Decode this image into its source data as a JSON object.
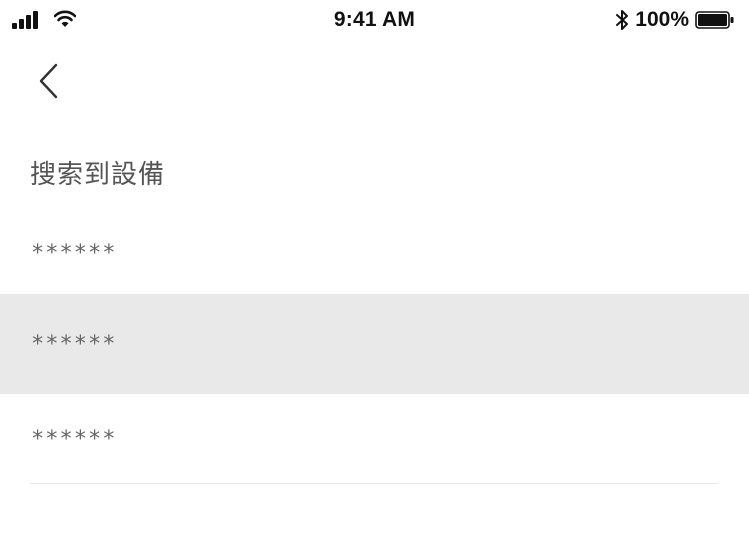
{
  "status_bar": {
    "time": "9:41 AM",
    "battery_percent": "100%",
    "battery_level": 1.0,
    "signal_icon": "signal-bars-icon",
    "wifi_icon": "wifi-icon",
    "bluetooth_icon": "bluetooth-icon",
    "battery_icon": "battery-icon"
  },
  "nav": {
    "back_icon": "chevron-left-icon"
  },
  "page": {
    "title": "搜索到設備"
  },
  "devices": [
    {
      "label": "******",
      "selected": false
    },
    {
      "label": "******",
      "selected": true
    },
    {
      "label": "******",
      "selected": false
    }
  ],
  "colors": {
    "selected_row_bg": "#e9e9e9",
    "title_text": "#555555",
    "item_text": "#666666"
  }
}
